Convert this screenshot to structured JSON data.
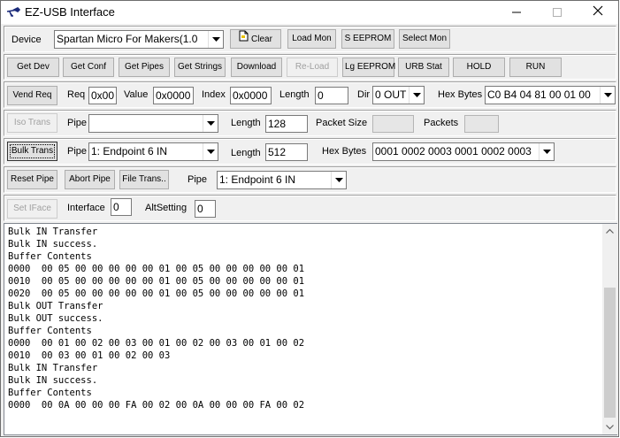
{
  "window": {
    "title": "EZ-USB Interface"
  },
  "device": {
    "label": "Device",
    "value": "Spartan Micro For Makers(1.0",
    "clear": "Clear",
    "load_mon": "Load Mon",
    "s_eeprom": "S EEPROM",
    "select_mon": "Select Mon"
  },
  "row2": {
    "get_dev": "Get Dev",
    "get_conf": "Get Conf",
    "get_pipes": "Get Pipes",
    "get_strings": "Get Strings",
    "download": "Download",
    "reload": "Re-Load",
    "lg_eeprom": "Lg EEPROM",
    "urb_stat": "URB Stat",
    "hold": "HOLD",
    "run": "RUN"
  },
  "vend": {
    "button": "Vend Req",
    "req_label": "Req",
    "req": "0x00",
    "value_label": "Value",
    "value": "0x0000",
    "index_label": "Index",
    "index": "0x0000",
    "length_label": "Length",
    "length": "0",
    "dir_label": "Dir",
    "dir": "0 OUT",
    "hex_label": "Hex Bytes",
    "hex": "C0 B4 04 81 00 01 00"
  },
  "iso": {
    "button": "Iso Trans",
    "pipe_label": "Pipe",
    "pipe": "",
    "length_label": "Length",
    "length": "128",
    "packet_size_label": "Packet Size",
    "packet_size": "",
    "packets_label": "Packets",
    "packets": ""
  },
  "bulk": {
    "button": "Bulk Trans",
    "pipe_label": "Pipe",
    "pipe": "1: Endpoint 6 IN",
    "length_label": "Length",
    "length": "512",
    "hex_label": "Hex Bytes",
    "hex": "0001 0002 0003 0001 0002 0003"
  },
  "reset": {
    "reset_pipe": "Reset Pipe",
    "abort_pipe": "Abort Pipe",
    "file_trans": "File Trans..",
    "pipe_label": "Pipe",
    "pipe": "1: Endpoint 6 IN"
  },
  "iface": {
    "button": "Set IFace",
    "interface_label": "Interface",
    "interface": "0",
    "alt_label": "AltSetting",
    "alt": "0"
  },
  "console": {
    "lines": [
      "Bulk IN Transfer",
      "Bulk IN success.",
      "Buffer Contents",
      "0000  00 05 00 00 00 00 00 01 00 05 00 00 00 00 00 01",
      "0010  00 05 00 00 00 00 00 01 00 05 00 00 00 00 00 01",
      "0020  00 05 00 00 00 00 00 01 00 05 00 00 00 00 00 01",
      "Bulk OUT Transfer",
      "Bulk OUT success.",
      "Buffer Contents",
      "0000  00 01 00 02 00 03 00 01 00 02 00 03 00 01 00 02",
      "0010  00 03 00 01 00 02 00 03",
      "Bulk IN Transfer",
      "Bulk IN success.",
      "Buffer Contents",
      "0000  00 0A 00 00 00 FA 00 02 00 0A 00 00 00 FA 00 02"
    ]
  }
}
